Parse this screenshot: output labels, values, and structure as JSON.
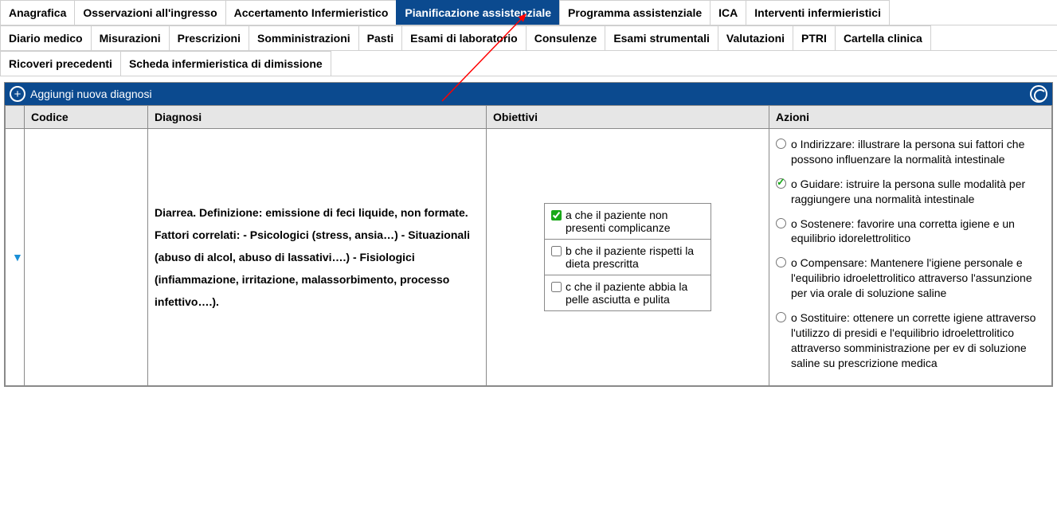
{
  "tabs_row1": [
    {
      "label": "Anagrafica",
      "active": false
    },
    {
      "label": "Osservazioni all'ingresso",
      "active": false
    },
    {
      "label": "Accertamento Infermieristico",
      "active": false
    },
    {
      "label": "Pianificazione assistenziale",
      "active": true
    },
    {
      "label": "Programma assistenziale",
      "active": false
    },
    {
      "label": "ICA",
      "active": false
    },
    {
      "label": "Interventi infermieristici",
      "active": false
    }
  ],
  "tabs_row2": [
    {
      "label": "Diario medico"
    },
    {
      "label": "Misurazioni"
    },
    {
      "label": "Prescrizioni"
    },
    {
      "label": "Somministrazioni"
    },
    {
      "label": "Pasti"
    },
    {
      "label": "Esami di laboratorio"
    },
    {
      "label": "Consulenze"
    },
    {
      "label": "Esami strumentali"
    },
    {
      "label": "Valutazioni"
    },
    {
      "label": "PTRI"
    },
    {
      "label": "Cartella clinica"
    }
  ],
  "tabs_row3": [
    {
      "label": "Ricoveri precedenti"
    },
    {
      "label": "Scheda infermieristica di dimissione"
    }
  ],
  "panel": {
    "add_label": "Aggiungi nuova diagnosi"
  },
  "columns": {
    "codice": "Codice",
    "diagnosi": "Diagnosi",
    "obiettivi": "Obiettivi",
    "azioni": "Azioni"
  },
  "row": {
    "codice": "",
    "diagnosi": "Diarrea. Definizione: emissione di feci liquide, non formate. Fattori correlati: - Psicologici (stress, ansia…) - Situazionali (abuso di alcol, abuso di lassativi….) - Fisiologici (infiammazione, irritazione, malassorbimento, processo infettivo….).",
    "obiettivi": [
      {
        "checked": true,
        "text": "a che il paziente non presenti complicanze"
      },
      {
        "checked": false,
        "text": "b che il paziente rispetti la dieta prescritta"
      },
      {
        "checked": false,
        "text": "c che il paziente abbia la pelle asciutta e pulita"
      }
    ],
    "azioni": [
      {
        "selected": false,
        "text": "o Indirizzare: illustrare la persona sui fattori che possono influenzare la normalità intestinale"
      },
      {
        "selected": true,
        "text": "o Guidare: istruire la persona sulle modalità per raggiungere una normalità intestinale"
      },
      {
        "selected": false,
        "text": "o Sostenere: favorire una corretta igiene e un equilibrio idorelettrolitico"
      },
      {
        "selected": false,
        "text": "o Compensare: Mantenere l'igiene personale e l'equilibrio idroelettrolitico attraverso l'assunzione per via orale di soluzione saline"
      },
      {
        "selected": false,
        "text": "o Sostituire: ottenere un corrette igiene attraverso l'utilizzo di presidi e l'equilibrio idroelettrolitico attraverso somministrazione per ev di soluzione saline su prescrizione medica"
      }
    ]
  }
}
